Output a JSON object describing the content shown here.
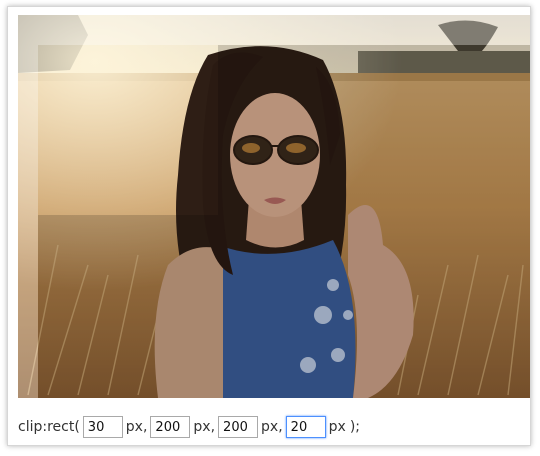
{
  "demo": {
    "prefix": "clip:rect(",
    "unit": "px,",
    "unit_last": "px",
    "suffix": ");",
    "top": "30",
    "right": "200",
    "bottom": "200",
    "left": "20"
  },
  "photo": {
    "subject": "woman-in-sunglasses-wheat-field",
    "colors": {
      "field": "#c89b5f",
      "sky": "#e8dcc4",
      "hair": "#2c1c14",
      "dress": "#3b5d9a",
      "skin": "#d9a98c"
    }
  }
}
